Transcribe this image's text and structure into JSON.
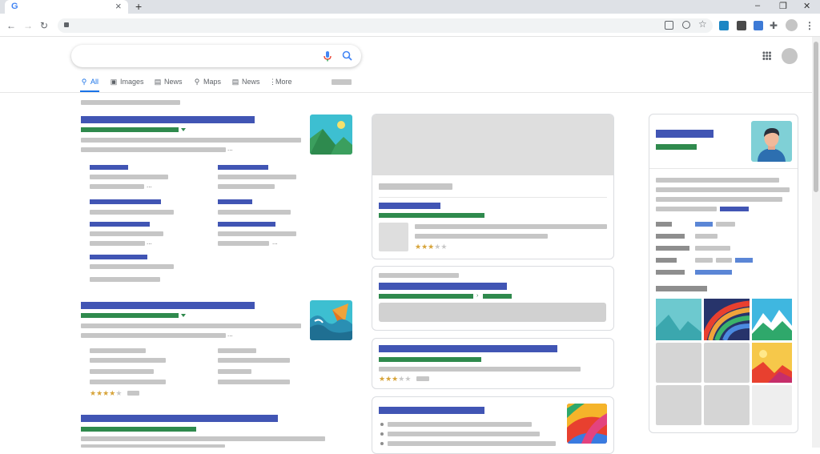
{
  "browser": {
    "tab_icon": "G",
    "new_tab": "+",
    "window": {
      "minimize": "–",
      "restore": "❐",
      "close": "✕"
    },
    "tab_close": "×",
    "nav": {
      "back": "←",
      "forward": "→",
      "reload": "↻",
      "lock": "🔒"
    },
    "toolbar_icons": {
      "menu": "⋮",
      "extensions": "✚"
    }
  },
  "search": {
    "query": "",
    "mic_icon": "mic-icon",
    "search_icon": "search-icon"
  },
  "tabs": [
    {
      "label": "All",
      "icon": "search-icon",
      "active": true
    },
    {
      "label": "Images",
      "icon": "image-icon"
    },
    {
      "label": "News",
      "icon": "news-icon"
    },
    {
      "label": "Maps",
      "icon": "map-pin-icon"
    },
    {
      "label": "News",
      "icon": "newspaper-icon"
    },
    {
      "label": "More",
      "icon": "more-vert-icon"
    }
  ],
  "ellipsis": "...",
  "ratings": {
    "card1": {
      "stars": 3,
      "of": 5
    },
    "card3": {
      "stars": 3,
      "of": 5
    },
    "result2": {
      "stars": 4,
      "of": 5
    }
  },
  "colors": {
    "link_blue": "#4155b4",
    "url_green": "#2f8a4d",
    "placeholder_gray": "#c6c6c6",
    "star_gold": "#d7a43a",
    "accent_blue": "#4285f4"
  }
}
